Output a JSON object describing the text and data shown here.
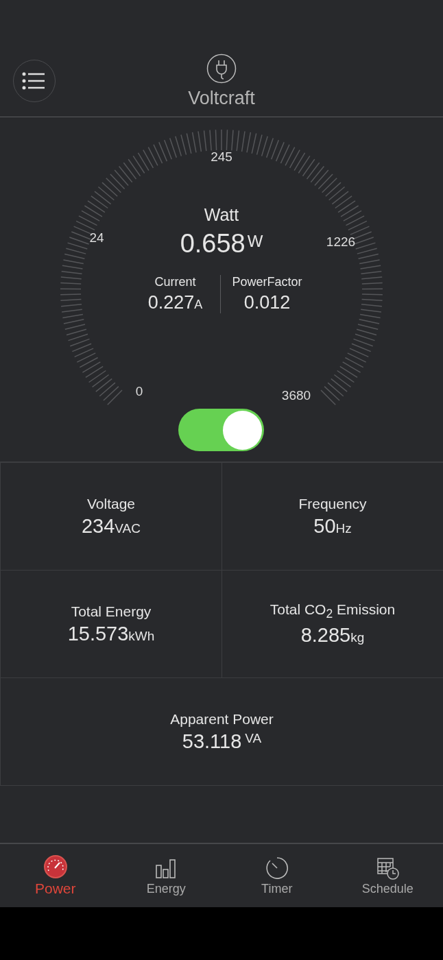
{
  "header": {
    "title": "Voltcraft"
  },
  "gauge": {
    "scale_labels": [
      "0",
      "24",
      "245",
      "1226",
      "3680"
    ],
    "label": "Watt",
    "value": "0.658",
    "unit": "W",
    "readings": [
      {
        "label": "Current",
        "value": "0.227",
        "unit": "A"
      },
      {
        "label": "PowerFactor",
        "value": "0.012"
      }
    ]
  },
  "power_switch": {
    "on": true
  },
  "tiles": [
    {
      "label": "Voltage",
      "value": "234",
      "unit": "VAC",
      "unit_raised": false
    },
    {
      "label": "Frequency",
      "value": "50",
      "unit": "Hz",
      "unit_raised": false
    },
    {
      "label": "Total Energy",
      "value": "15.573",
      "unit": "kWh",
      "unit_raised": false
    },
    {
      "label": "Total CO$_{2}$ Emission",
      "value": "8.285",
      "unit": "kg",
      "unit_raised": false
    },
    {
      "label": "Apparent Power",
      "value": "53.118",
      "unit": "VA",
      "unit_raised": true
    }
  ],
  "tabs": [
    {
      "label": "Power",
      "kind": "gauge",
      "selected": true
    },
    {
      "label": "Energy",
      "kind": "bars",
      "selected": false
    },
    {
      "label": "Timer",
      "kind": "timer",
      "selected": false
    },
    {
      "label": "Schedule",
      "kind": "calendar",
      "selected": false
    }
  ]
}
